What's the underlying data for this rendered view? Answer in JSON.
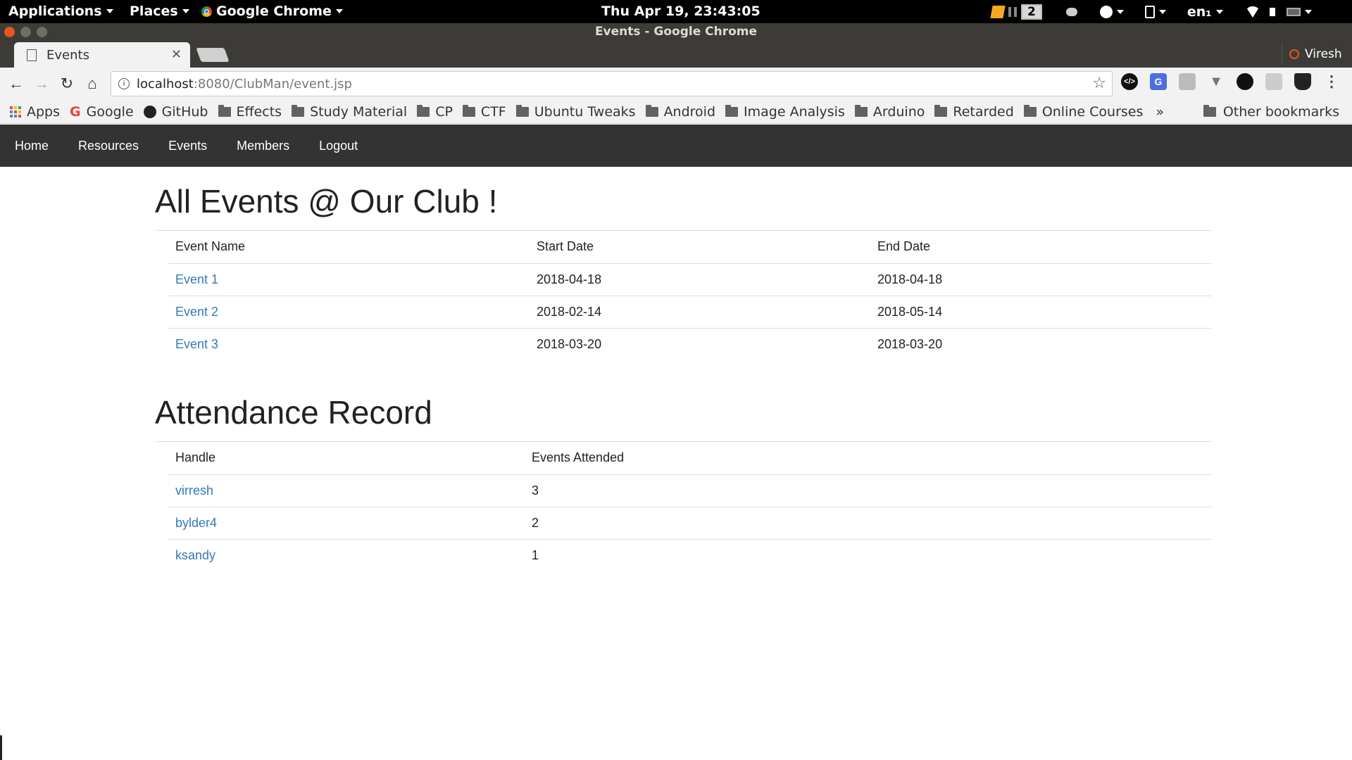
{
  "system_bar": {
    "applications": "Applications",
    "places": "Places",
    "active_app": "Google Chrome",
    "clock": "Thu Apr 19, 23:43:05",
    "workspace": "2",
    "keyboard_layout": "en₁"
  },
  "window": {
    "title": "Events - Google Chrome"
  },
  "tabs": [
    {
      "title": "Events",
      "active": true
    }
  ],
  "profile": {
    "name": "Viresh"
  },
  "omnibox": {
    "host": "localhost",
    "path": ":8080/ClubMan/event.jsp"
  },
  "bookmarks": {
    "items": [
      "Apps",
      "Google",
      "GitHub",
      "Effects",
      "Study Material",
      "CP",
      "CTF",
      "Ubuntu Tweaks",
      "Android",
      "Image Analysis",
      "Arduino",
      "Retarded",
      "Online Courses"
    ],
    "overflow": "»",
    "other": "Other bookmarks"
  },
  "site_nav": [
    "Home",
    "Resources",
    "Events",
    "Members",
    "Logout"
  ],
  "events_section": {
    "title": "All Events @ Our Club !",
    "headers": [
      "Event Name",
      "Start Date",
      "End Date"
    ],
    "rows": [
      [
        "Event 1",
        "2018-04-18",
        "2018-04-18"
      ],
      [
        "Event 2",
        "2018-02-14",
        "2018-05-14"
      ],
      [
        "Event 3",
        "2018-03-20",
        "2018-03-20"
      ]
    ]
  },
  "attendance_section": {
    "title": "Attendance Record",
    "headers": [
      "Handle",
      "Events Attended"
    ],
    "rows": [
      [
        "virresh",
        "3"
      ],
      [
        "bylder4",
        "2"
      ],
      [
        "ksandy",
        "1"
      ]
    ]
  },
  "colors": {
    "nav_bg": "#333333",
    "link": "#337ab7",
    "titlebar": "#3c3b37",
    "close_button": "#e9541f"
  }
}
